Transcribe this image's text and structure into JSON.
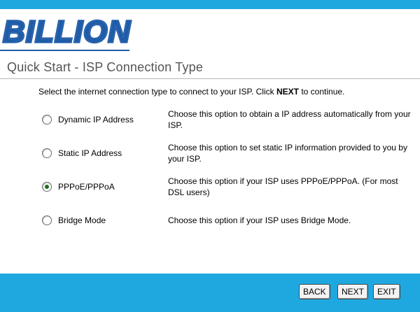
{
  "brand": {
    "logo_text": "BILLION",
    "primary_color": "#1fa8e0",
    "logo_color": "#1f5ca8"
  },
  "page": {
    "title": "Quick Start - ISP Connection Type"
  },
  "instruction": {
    "before": "Select the internet connection type to connect to your ISP. Click ",
    "emphasis": "NEXT",
    "after": " to continue."
  },
  "options": [
    {
      "label": "Dynamic IP Address",
      "checked": false,
      "description": "Choose this option to obtain a IP address automatically from your ISP."
    },
    {
      "label": "Static IP Address",
      "checked": false,
      "description": "Choose this option to set static IP information provided to you by your ISP."
    },
    {
      "label": "PPPoE/PPPoA",
      "checked": true,
      "description": "Choose this option if your ISP uses PPPoE/PPPoA. (For most DSL users)"
    },
    {
      "label": "Bridge Mode",
      "checked": false,
      "description": "Choose this option if your ISP uses Bridge Mode."
    }
  ],
  "buttons": {
    "back": "BACK",
    "next": "NEXT",
    "exit": "EXIT"
  }
}
